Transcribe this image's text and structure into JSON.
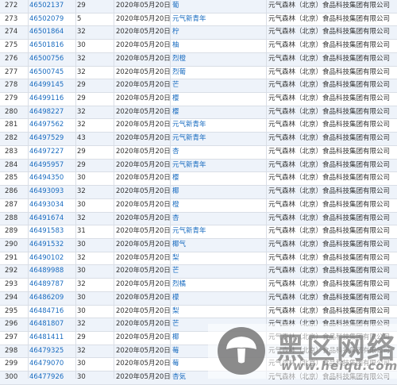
{
  "trademark_table": {
    "rows": [
      {
        "index": "272",
        "reg_no": "46502137",
        "class": "29",
        "date": "2020年05月20日",
        "name": "葡",
        "applicant": "元气森林（北京）食品科技集团有限公司"
      },
      {
        "index": "273",
        "reg_no": "46502079",
        "class": "5",
        "date": "2020年05月20日",
        "name": "元气新青年",
        "applicant": "元气森林（北京）食品科技集团有限公司"
      },
      {
        "index": "274",
        "reg_no": "46501864",
        "class": "32",
        "date": "2020年05月20日",
        "name": "柠",
        "applicant": "元气森林（北京）食品科技集团有限公司"
      },
      {
        "index": "275",
        "reg_no": "46501816",
        "class": "30",
        "date": "2020年05月20日",
        "name": "柚",
        "applicant": "元气森林（北京）食品科技集团有限公司"
      },
      {
        "index": "276",
        "reg_no": "46500756",
        "class": "32",
        "date": "2020年05月20日",
        "name": "烈橙",
        "applicant": "元气森林（北京）食品科技集团有限公司"
      },
      {
        "index": "277",
        "reg_no": "46500745",
        "class": "32",
        "date": "2020年05月20日",
        "name": "烈葡",
        "applicant": "元气森林（北京）食品科技集团有限公司"
      },
      {
        "index": "278",
        "reg_no": "46499145",
        "class": "29",
        "date": "2020年05月20日",
        "name": "芒",
        "applicant": "元气森林（北京）食品科技集团有限公司"
      },
      {
        "index": "279",
        "reg_no": "46499116",
        "class": "29",
        "date": "2020年05月20日",
        "name": "樱",
        "applicant": "元气森林（北京）食品科技集团有限公司"
      },
      {
        "index": "280",
        "reg_no": "46498227",
        "class": "32",
        "date": "2020年05月20日",
        "name": "樱",
        "applicant": "元气森林（北京）食品科技集团有限公司"
      },
      {
        "index": "281",
        "reg_no": "46497562",
        "class": "32",
        "date": "2020年05月20日",
        "name": "元气新青年",
        "applicant": "元气森林（北京）食品科技集团有限公司"
      },
      {
        "index": "282",
        "reg_no": "46497529",
        "class": "43",
        "date": "2020年05月20日",
        "name": "元气新青年",
        "applicant": "元气森林（北京）食品科技集团有限公司"
      },
      {
        "index": "283",
        "reg_no": "46497227",
        "class": "29",
        "date": "2020年05月20日",
        "name": "杏",
        "applicant": "元气森林（北京）食品科技集团有限公司"
      },
      {
        "index": "284",
        "reg_no": "46495957",
        "class": "29",
        "date": "2020年05月20日",
        "name": "元气新青年",
        "applicant": "元气森林（北京）食品科技集团有限公司"
      },
      {
        "index": "285",
        "reg_no": "46494350",
        "class": "30",
        "date": "2020年05月20日",
        "name": "樱",
        "applicant": "元气森林（北京）食品科技集团有限公司"
      },
      {
        "index": "286",
        "reg_no": "46493093",
        "class": "32",
        "date": "2020年05月20日",
        "name": "椰",
        "applicant": "元气森林（北京）食品科技集团有限公司"
      },
      {
        "index": "287",
        "reg_no": "46493034",
        "class": "30",
        "date": "2020年05月20日",
        "name": "橙",
        "applicant": "元气森林（北京）食品科技集团有限公司"
      },
      {
        "index": "288",
        "reg_no": "46491674",
        "class": "32",
        "date": "2020年05月20日",
        "name": "杏",
        "applicant": "元气森林（北京）食品科技集团有限公司"
      },
      {
        "index": "289",
        "reg_no": "46491583",
        "class": "31",
        "date": "2020年05月20日",
        "name": "元气新青年",
        "applicant": "元气森林（北京）食品科技集团有限公司"
      },
      {
        "index": "290",
        "reg_no": "46491532",
        "class": "30",
        "date": "2020年05月20日",
        "name": "椰气",
        "applicant": "元气森林（北京）食品科技集团有限公司"
      },
      {
        "index": "291",
        "reg_no": "46490102",
        "class": "32",
        "date": "2020年05月20日",
        "name": "梨",
        "applicant": "元气森林（北京）食品科技集团有限公司"
      },
      {
        "index": "292",
        "reg_no": "46489988",
        "class": "30",
        "date": "2020年05月20日",
        "name": "芒",
        "applicant": "元气森林（北京）食品科技集团有限公司"
      },
      {
        "index": "293",
        "reg_no": "46489787",
        "class": "32",
        "date": "2020年05月20日",
        "name": "烈橘",
        "applicant": "元气森林（北京）食品科技集团有限公司"
      },
      {
        "index": "294",
        "reg_no": "46486209",
        "class": "30",
        "date": "2020年05月20日",
        "name": "檬",
        "applicant": "元气森林（北京）食品科技集团有限公司"
      },
      {
        "index": "295",
        "reg_no": "46484716",
        "class": "30",
        "date": "2020年05月20日",
        "name": "梨",
        "applicant": "元气森林（北京）食品科技集团有限公司"
      },
      {
        "index": "296",
        "reg_no": "46481807",
        "class": "32",
        "date": "2020年05月20日",
        "name": "芒",
        "applicant": "元气森林（北京）食品科技集团有限公司"
      },
      {
        "index": "297",
        "reg_no": "46481411",
        "class": "29",
        "date": "2020年05月20日",
        "name": "椰",
        "applicant": "元气森林（北京）食品科技集团有限公司"
      },
      {
        "index": "298",
        "reg_no": "46479325",
        "class": "32",
        "date": "2020年05月20日",
        "name": "莓",
        "applicant": "元气森林（北京）食品科技集团有限公司"
      },
      {
        "index": "299",
        "reg_no": "46479070",
        "class": "30",
        "date": "2020年05月20日",
        "name": "莓",
        "applicant": "元气森林（北京）食品科技集团有限公司"
      },
      {
        "index": "300",
        "reg_no": "46477926",
        "class": "30",
        "date": "2020年05月20日",
        "name": "杏気",
        "applicant": "元气森林（北京）食品科技集团有限公司"
      }
    ]
  },
  "watermark": {
    "title": "黑区网络",
    "url": "www.heiqu.com",
    "icon": "mushroom-logo-icon"
  },
  "colors": {
    "link": "#1a6cc0",
    "row_alt": "#eef3fa",
    "grid": "#d9dee6"
  }
}
